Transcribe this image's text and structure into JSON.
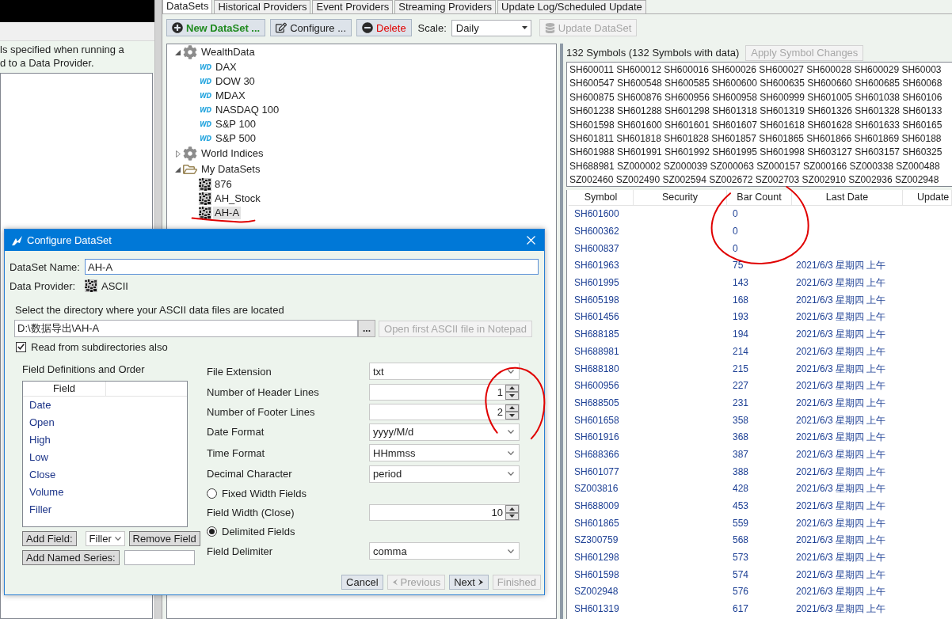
{
  "left_panel": {
    "note": "ls specified when running a\nd to a Data Provider."
  },
  "tabs": [
    {
      "label": "DataSets",
      "selected": true
    },
    {
      "label": "Historical Providers",
      "selected": false
    },
    {
      "label": "Event Providers",
      "selected": false
    },
    {
      "label": "Streaming Providers",
      "selected": false
    },
    {
      "label": "Update Log/Scheduled Update",
      "selected": false
    }
  ],
  "toolbar": {
    "buttons": [
      {
        "kind": "new",
        "label": "New DataSet ...",
        "disabled": false
      },
      {
        "kind": "configure",
        "label": "Configure ...",
        "disabled": false
      },
      {
        "kind": "delete",
        "label": "Delete",
        "disabled": false
      }
    ],
    "scale_label": "Scale:",
    "scale_value": "Daily",
    "update_button": {
      "label": "Update DataSet",
      "disabled": true
    }
  },
  "tree": [
    {
      "kind": "provider",
      "label": "WealthData",
      "expanded": true,
      "selected": false,
      "children": [
        {
          "kind": "index",
          "logo": "WD",
          "label": "DAX",
          "selected": false
        },
        {
          "kind": "index",
          "logo": "WD",
          "label": "DOW 30",
          "selected": false
        },
        {
          "kind": "index",
          "logo": "WD",
          "label": "MDAX",
          "selected": false
        },
        {
          "kind": "index",
          "logo": "WD",
          "label": "NASDAQ 100",
          "selected": false
        },
        {
          "kind": "index",
          "logo": "WD",
          "label": "S&P 100",
          "selected": false
        },
        {
          "kind": "index",
          "logo": "WD",
          "label": "S&P 500",
          "selected": false
        }
      ]
    },
    {
      "kind": "provider",
      "label": "World Indices",
      "expanded": false,
      "selected": false
    },
    {
      "kind": "group",
      "label": "My DataSets",
      "expanded": true,
      "selected": false,
      "children": [
        {
          "kind": "dataset",
          "label": "876",
          "selected": false
        },
        {
          "kind": "dataset",
          "label": "AH_Stock",
          "selected": false
        },
        {
          "kind": "dataset",
          "label": "AH-A",
          "selected": true
        }
      ]
    }
  ],
  "symbols": {
    "summary": "132 Symbols (132 Symbols with data)",
    "apply_button": {
      "label": "Apply Symbol Changes",
      "disabled": true
    },
    "lines": [
      "SH600011 SH600012 SH600016 SH600026 SH600027 SH600028 SH600029 SH60003",
      "SH600547 SH600548 SH600585 SH600600 SH600635 SH600660 SH600685 SH60068",
      "SH600875 SH600876 SH600956 SH600958 SH600999 SH601005 SH601038 SH60106",
      "SH601238 SH601288 SH601298 SH601318 SH601319 SH601326 SH601328 SH60133",
      "SH601598 SH601600 SH601601 SH601607 SH601618 SH601628 SH601633 SH60165",
      "SH601811 SH601818 SH601828 SH601857 SH601865 SH601866 SH601869 SH60188",
      "SH601988 SH601991 SH601992 SH601995 SH601998 SH603127 SH603157 SH60325",
      "SH688981 SZ000002 SZ000039 SZ000063 SZ000157 SZ000166 SZ000338 SZ000488",
      "SZ002460 SZ002490 SZ002594 SZ002672 SZ002703 SZ002910 SZ002936 SZ002948"
    ]
  },
  "table": {
    "columns": [
      "Symbol",
      "Security",
      "Bar Count",
      "Last Date",
      "Update"
    ],
    "rows": [
      {
        "symbol": "SH601600",
        "bar_count": "0"
      },
      {
        "symbol": "SH600362",
        "bar_count": "0"
      },
      {
        "symbol": "SH600837",
        "bar_count": "0"
      },
      {
        "symbol": "SH601963",
        "bar_count": "75",
        "last_date": "2021/6/3 星期四 上午"
      },
      {
        "symbol": "SH601995",
        "bar_count": "143",
        "last_date": "2021/6/3 星期四 上午"
      },
      {
        "symbol": "SH605198",
        "bar_count": "168",
        "last_date": "2021/6/3 星期四 上午"
      },
      {
        "symbol": "SH601456",
        "bar_count": "193",
        "last_date": "2021/6/3 星期四 上午"
      },
      {
        "symbol": "SH688185",
        "bar_count": "194",
        "last_date": "2021/6/3 星期四 上午"
      },
      {
        "symbol": "SH688981",
        "bar_count": "214",
        "last_date": "2021/6/3 星期四 上午"
      },
      {
        "symbol": "SH688180",
        "bar_count": "215",
        "last_date": "2021/6/3 星期四 上午"
      },
      {
        "symbol": "SH600956",
        "bar_count": "227",
        "last_date": "2021/6/3 星期四 上午"
      },
      {
        "symbol": "SH688505",
        "bar_count": "231",
        "last_date": "2021/6/3 星期四 上午"
      },
      {
        "symbol": "SH601658",
        "bar_count": "358",
        "last_date": "2021/6/3 星期四 上午"
      },
      {
        "symbol": "SH601916",
        "bar_count": "368",
        "last_date": "2021/6/3 星期四 上午"
      },
      {
        "symbol": "SH688366",
        "bar_count": "387",
        "last_date": "2021/6/3 星期四 上午"
      },
      {
        "symbol": "SH601077",
        "bar_count": "388",
        "last_date": "2021/6/3 星期四 上午"
      },
      {
        "symbol": "SZ003816",
        "bar_count": "428",
        "last_date": "2021/6/3 星期四 上午"
      },
      {
        "symbol": "SH688009",
        "bar_count": "453",
        "last_date": "2021/6/3 星期四 上午"
      },
      {
        "symbol": "SH601865",
        "bar_count": "559",
        "last_date": "2021/6/3 星期四 上午"
      },
      {
        "symbol": "SZ300759",
        "bar_count": "568",
        "last_date": "2021/6/3 星期四 上午"
      },
      {
        "symbol": "SH601298",
        "bar_count": "573",
        "last_date": "2021/6/3 星期四 上午"
      },
      {
        "symbol": "SH601598",
        "bar_count": "574",
        "last_date": "2021/6/3 星期四 上午"
      },
      {
        "symbol": "SZ002948",
        "bar_count": "576",
        "last_date": "2021/6/3 星期四 上午"
      },
      {
        "symbol": "SH601319",
        "bar_count": "617",
        "last_date": "2021/6/3 星期四 上午"
      }
    ]
  },
  "dialog": {
    "title": "Configure DataSet",
    "name_label": "DataSet Name:",
    "name_value": "AH-A",
    "provider_label": "Data Provider:",
    "provider_value": "ASCII",
    "directory_prompt": "Select the directory where your ASCII data files are located",
    "directory_value": "D:\\数据导出\\AH-A",
    "browse_button": "...",
    "notepad_button": {
      "label": "Open first ASCII file in Notepad",
      "disabled": true
    },
    "subdirectories": {
      "label": "Read from subdirectories also",
      "checked": true
    },
    "fields_title": "Field Definitions and Order",
    "fields_list": {
      "header": "Field",
      "items": [
        "Date",
        "Open",
        "High",
        "Low",
        "Close",
        "Volume",
        "Filler"
      ]
    },
    "add_field_button": "Add Field:",
    "field_type_value": "Filler",
    "remove_field_button": "Remove Field",
    "add_series_button": "Add Named Series:",
    "settings": [
      {
        "kind": "select",
        "label": "File Extension",
        "value": "txt"
      },
      {
        "kind": "spinner",
        "label": "Number of Header Lines",
        "value": "1"
      },
      {
        "kind": "spinner",
        "label": "Number of Footer Lines",
        "value": "2"
      },
      {
        "kind": "select",
        "label": "Date Format",
        "value": "yyyy/M/d"
      },
      {
        "kind": "select",
        "label": "Time Format",
        "value": "HHmmss"
      },
      {
        "kind": "select",
        "label": "Decimal Character",
        "value": "period"
      },
      {
        "kind": "radio",
        "label": "Fixed Width Fields",
        "selected": false
      },
      {
        "kind": "spinner",
        "label": "Field Width (Close)",
        "value": "10"
      },
      {
        "kind": "radio",
        "label": "Delimited Fields",
        "selected": true
      },
      {
        "kind": "select",
        "label": "Field Delimiter",
        "value": "comma"
      }
    ],
    "buttons": [
      {
        "kind": "plain",
        "label": "Cancel",
        "disabled": false
      },
      {
        "kind": "back",
        "label": "Previous",
        "disabled": true
      },
      {
        "kind": "forward",
        "label": "Next",
        "disabled": false
      },
      {
        "kind": "plain",
        "label": "Finished",
        "disabled": true
      }
    ]
  },
  "annotations": [
    {
      "kind": "circle"
    },
    {
      "kind": "underline"
    },
    {
      "kind": "circle"
    }
  ]
}
